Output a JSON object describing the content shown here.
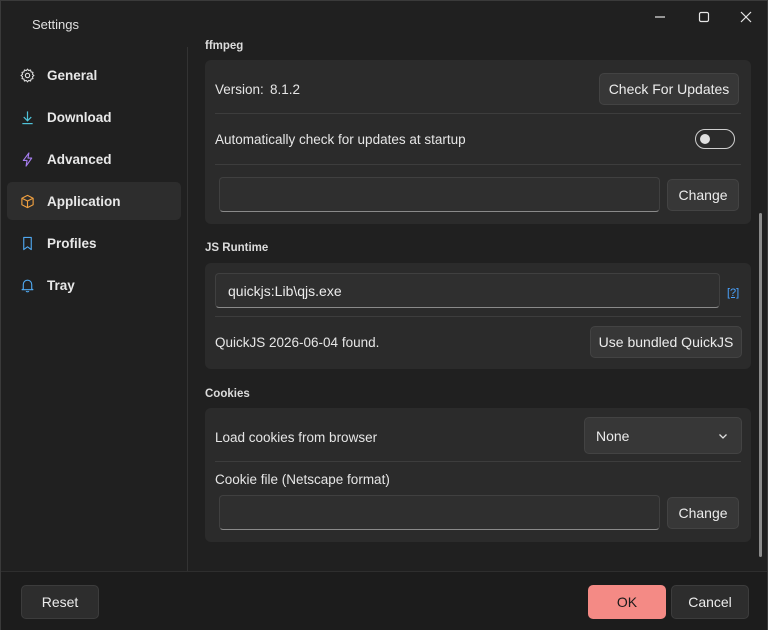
{
  "window": {
    "title": "Settings"
  },
  "sidebar": {
    "items": [
      {
        "label": "General",
        "icon": "gear-icon"
      },
      {
        "label": "Download",
        "icon": "download-icon"
      },
      {
        "label": "Advanced",
        "icon": "lightning-icon"
      },
      {
        "label": "Application",
        "icon": "box-icon",
        "selected": true
      },
      {
        "label": "Profiles",
        "icon": "bookmark-icon"
      },
      {
        "label": "Tray",
        "icon": "bell-icon"
      }
    ]
  },
  "ffmpeg": {
    "section_label": "ffmpeg",
    "version_label": "Version:",
    "version_value": "8.1.2",
    "check_updates_label": "Check For Updates",
    "auto_check_label": "Automatically check for updates at startup",
    "auto_check_enabled": false,
    "path_value": "",
    "change_label": "Change"
  },
  "js_runtime": {
    "section_label": "JS Runtime",
    "path_value": "quickjs:Lib\\qjs.exe",
    "help_label": "[?]",
    "status_text": "QuickJS 2026-06-04 found.",
    "use_bundled_label": "Use bundled QuickJS"
  },
  "cookies": {
    "section_label": "Cookies",
    "load_from_browser_label": "Load cookies from browser",
    "browser_selected": "None",
    "cookie_file_label": "Cookie file (Netscape format)",
    "cookie_file_value": "",
    "change_label": "Change"
  },
  "footer": {
    "reset_label": "Reset",
    "ok_label": "OK",
    "cancel_label": "Cancel"
  },
  "colors": {
    "accent": "#f48a85",
    "link": "#4aa3ff"
  }
}
